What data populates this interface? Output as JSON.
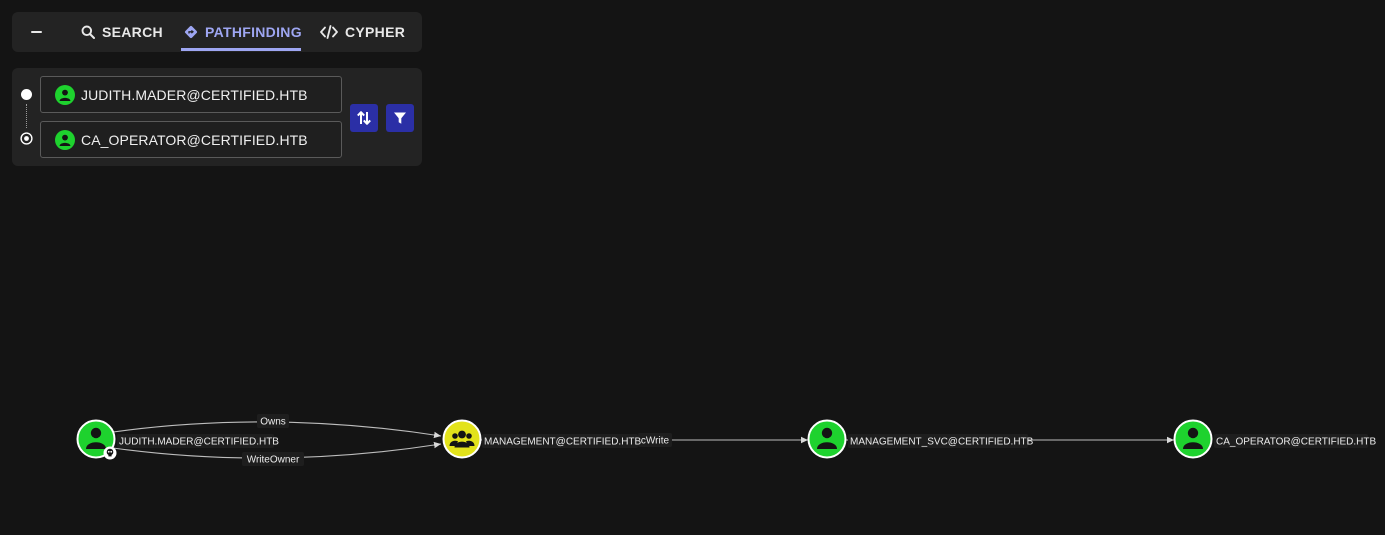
{
  "tabs": {
    "collapse_icon": "minus-icon",
    "search_label": "SEARCH",
    "pathfinding_label": "PATHFINDING",
    "cypher_label": "CYPHER",
    "active": "PATHFINDING",
    "active_color": "#9ea6f2"
  },
  "pathfinding": {
    "start_node": "JUDITH.MADER@CERTIFIED.HTB",
    "end_node": "CA_OPERATOR@CERTIFIED.HTB",
    "swap_icon": "swap-vertical-icon",
    "filter_icon": "filter-icon",
    "button_color": "#2b2fa6"
  },
  "graph": {
    "nodes": [
      {
        "label": "JUDITH.MADER@CERTIFIED.HTB",
        "type": "user",
        "color": "#1ed22e",
        "owned": true
      },
      {
        "label": "MANAGEMENT@CERTIFIED.HTB",
        "type": "group",
        "color": "#e3e31b"
      },
      {
        "label": "MANAGEMENT_SVC@CERTIFIED.HTB",
        "type": "user",
        "color": "#1ed22e"
      },
      {
        "label": "CA_OPERATOR@CERTIFIED.HTB",
        "type": "user",
        "color": "#1ed22e"
      }
    ],
    "edges": [
      {
        "label": "Owns",
        "from": "JUDITH.MADER@CERTIFIED.HTB",
        "to": "MANAGEMENT@CERTIFIED.HTB"
      },
      {
        "label": "WriteOwner",
        "from": "JUDITH.MADER@CERTIFIED.HTB",
        "to": "MANAGEMENT@CERTIFIED.HTB"
      },
      {
        "label": "cWrite",
        "from": "MANAGEMENT@CERTIFIED.HTB",
        "to": "MANAGEMENT_SVC@CERTIFIED.HTB"
      },
      {
        "label": "",
        "from": "MANAGEMENT_SVC@CERTIFIED.HTB",
        "to": "CA_OPERATOR@CERTIFIED.HTB"
      }
    ]
  }
}
